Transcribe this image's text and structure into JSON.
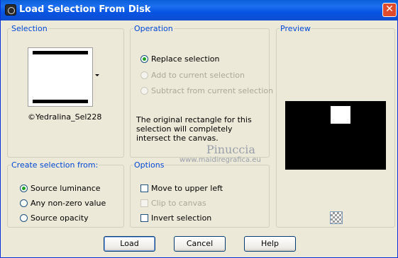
{
  "window": {
    "title": "Load Selection From Disk",
    "app_icon": "camera-icon",
    "close_glyph": "✕"
  },
  "selection": {
    "legend": "Selection",
    "file_name": "©Yedralina_Sel228",
    "dropdown_icon": "dropdown-arrow-icon"
  },
  "operation": {
    "legend": "Operation",
    "options": [
      {
        "label": "Replace selection",
        "checked": true,
        "enabled": true
      },
      {
        "label": "Add to current selection",
        "checked": false,
        "enabled": false
      },
      {
        "label": "Subtract from current selection",
        "checked": false,
        "enabled": false
      }
    ],
    "description": "The original rectangle for this selection will completely intersect the canvas."
  },
  "preview": {
    "legend": "Preview",
    "transparency_icon": "checkerboard-icon"
  },
  "create_from": {
    "legend": "Create selection from:",
    "options": [
      {
        "label": "Source luminance",
        "checked": true
      },
      {
        "label": "Any non-zero value",
        "checked": false
      },
      {
        "label": "Source opacity",
        "checked": false
      }
    ]
  },
  "options": {
    "legend": "Options",
    "items": [
      {
        "label": "Move to upper left",
        "checked": false,
        "enabled": true
      },
      {
        "label": "Clip to canvas",
        "checked": false,
        "enabled": false
      },
      {
        "label": "Invert selection",
        "checked": false,
        "enabled": true
      }
    ]
  },
  "watermark": {
    "line1": "Pinuccia",
    "line2": "www.maidiregrafica.eu"
  },
  "buttons": {
    "load": "Load",
    "cancel": "Cancel",
    "help": "Help"
  },
  "colors": {
    "titlebar": "#0a5fd8",
    "legend_text": "#0046d5",
    "dialog_bg": "#ece9d8",
    "close_button": "#e04c2b"
  }
}
